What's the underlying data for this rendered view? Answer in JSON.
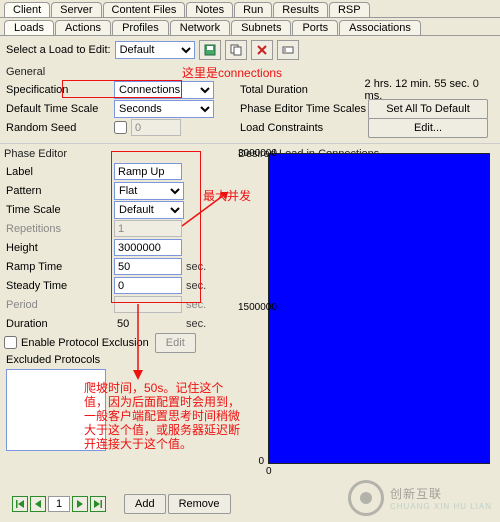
{
  "tabs_top": [
    "Client",
    "Server",
    "Content Files",
    "Notes",
    "Run",
    "Results",
    "RSP"
  ],
  "tabs_top_active": 0,
  "tabs_sub": [
    "Loads",
    "Actions",
    "Profiles",
    "Network",
    "Subnets",
    "Ports",
    "Associations"
  ],
  "tabs_sub_active": 0,
  "toolbar": {
    "select_label": "Select a Load to Edit:",
    "load_select": "Default"
  },
  "general": {
    "label": "General",
    "spec_label": "Specification",
    "spec_value": "Connections",
    "dts_label": "Default Time Scale",
    "dts_value": "Seconds",
    "seed_label": "Random Seed",
    "seed_value": "0",
    "total_dur_label": "Total Duration",
    "total_dur_value": "2 hrs. 12 min. 55 sec. 0 ms.",
    "pets_label": "Phase Editor Time Scales",
    "pets_btn": "Set All To Default",
    "lc_label": "Load Constraints",
    "lc_btn": "Edit..."
  },
  "annotations": {
    "a1": "这里是connections",
    "a2": "最大并发",
    "a3": "爬坡时间，50s。记住这个值，因为后面配置时会用到，一般客户端配置思考时间稍微大于这个值，或服务器延迟断开连接大于这个值。"
  },
  "phase": {
    "title": "Phase Editor",
    "label_l": "Label",
    "label_v": "Ramp Up",
    "pattern_l": "Pattern",
    "pattern_v": "Flat",
    "ts_l": "Time Scale",
    "ts_v": "Default",
    "rep_l": "Repetitions",
    "rep_v": "1",
    "h_l": "Height",
    "h_v": "3000000",
    "rt_l": "Ramp Time",
    "rt_v": "50",
    "rt_u": "sec.",
    "st_l": "Steady Time",
    "st_v": "0",
    "st_u": "sec.",
    "per_l": "Period",
    "per_u": "sec.",
    "dur_l": "Duration",
    "dur_v": "50",
    "dur_u": "sec.",
    "epe_l": "Enable Protocol Exclusion",
    "epe_btn": "Edit",
    "exc_l": "Excluded Protocols"
  },
  "chart_data": {
    "type": "line",
    "title": "Desired Load in Connections",
    "xlabel": "",
    "ylabel": "",
    "ylim": [
      0,
      3000000
    ],
    "yticks": [
      0,
      1500000,
      3000000
    ],
    "xticks": [
      0
    ],
    "x": [
      0,
      50,
      7975
    ],
    "y": [
      0,
      3000000,
      3000000
    ]
  },
  "pager": {
    "page": "1",
    "add": "Add",
    "remove": "Remove"
  },
  "logo": {
    "brand": "创新互联",
    "url": "CHUANG XIN HU LIAN"
  }
}
